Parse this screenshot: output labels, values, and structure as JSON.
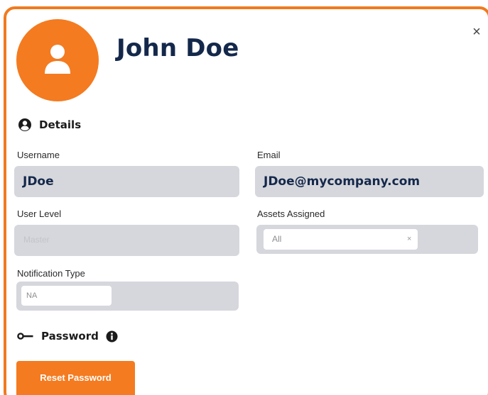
{
  "profile": {
    "name": "John Doe",
    "avatar_icon": "user-icon",
    "close_icon": "close-icon",
    "close_glyph": "×"
  },
  "details": {
    "title": "Details",
    "icon": "user-circle-icon",
    "username": {
      "label": "Username",
      "value": "JDoe"
    },
    "email": {
      "label": "Email",
      "value": "JDoe@mycompany.com"
    },
    "user_level": {
      "label": "User Level",
      "value": "Master"
    },
    "assets_assigned": {
      "label": "Assets Assigned",
      "value": "All",
      "clear_glyph": "×"
    },
    "notification_type": {
      "label": "Notification Type",
      "value": "NA"
    }
  },
  "password": {
    "title": "Password",
    "key_icon": "key-icon",
    "info_icon": "info-icon",
    "reset_label": "Reset Password"
  },
  "colors": {
    "accent": "#f47b20",
    "name_text": "#14284b",
    "field_bg": "#d6d7dc"
  }
}
